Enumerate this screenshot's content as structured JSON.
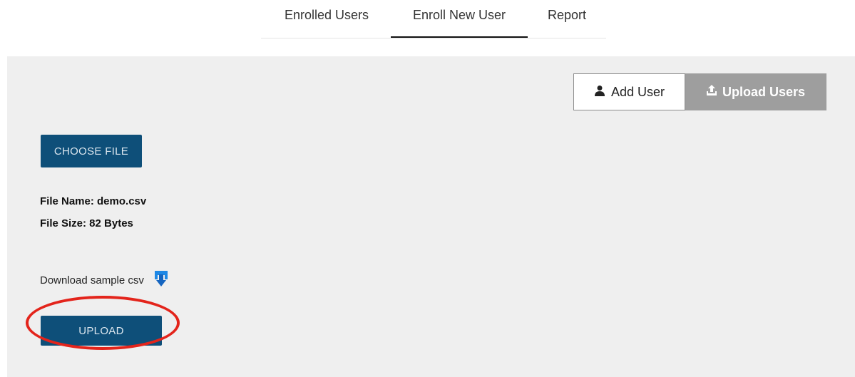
{
  "tabs": {
    "enrolled_users": "Enrolled Users",
    "enroll_new_user": "Enroll New User",
    "report": "Report",
    "active": "enroll_new_user"
  },
  "mode_toggle": {
    "add_user": "Add User",
    "add_user_icon": "user-icon",
    "upload_users": "Upload Users",
    "upload_users_icon": "upload-icon",
    "active": "upload_users"
  },
  "file_upload": {
    "choose_label": "CHOOSE FILE",
    "file_name": "File Name: demo.csv",
    "file_size": "File Size: 82 Bytes",
    "download_sample_label": "Download sample csv",
    "download_icon": "download-icon",
    "upload_label": "UPLOAD"
  },
  "colors": {
    "primary_button": "#0e4f79",
    "panel_background": "#efefef",
    "active_toggle": "#9e9e9e",
    "highlight": "#e3241b",
    "download_icon": "#1e88e5"
  }
}
